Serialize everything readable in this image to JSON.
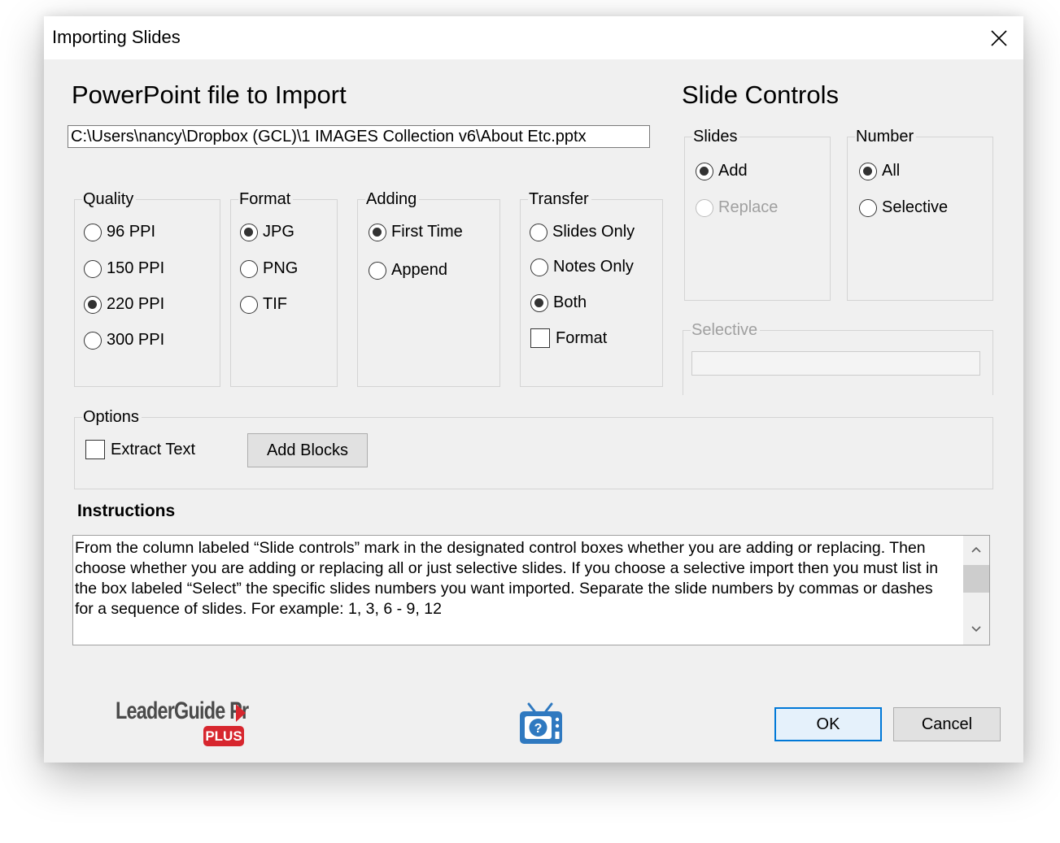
{
  "window": {
    "title": "Importing Slides"
  },
  "import": {
    "heading": "PowerPoint file to Import",
    "file_path": "C:\\Users\\nancy\\Dropbox (GCL)\\1 IMAGES Collection v6\\About Etc.pptx"
  },
  "quality": {
    "label": "Quality",
    "options": [
      "96 PPI",
      "150 PPI",
      "220 PPI",
      "300 PPI"
    ],
    "selected": "220 PPI"
  },
  "format": {
    "label": "Format",
    "options": [
      "JPG",
      "PNG",
      "TIF"
    ],
    "selected": "JPG"
  },
  "adding": {
    "label": "Adding",
    "options": [
      "First Time",
      "Append"
    ],
    "selected": "First Time"
  },
  "transfer": {
    "label": "Transfer",
    "options": [
      "Slides Only",
      "Notes Only",
      "Both"
    ],
    "selected": "Both",
    "format_checkbox": "Format"
  },
  "slide_controls": {
    "heading": "Slide Controls",
    "slides": {
      "label": "Slides",
      "options": [
        "Add",
        "Replace"
      ],
      "selected": "Add"
    },
    "number": {
      "label": "Number",
      "options": [
        "All",
        "Selective"
      ],
      "selected": "All"
    },
    "selective": {
      "label": "Selective",
      "value": ""
    }
  },
  "options": {
    "label": "Options",
    "extract_text": "Extract Text",
    "add_blocks": "Add Blocks"
  },
  "instructions": {
    "label": "Instructions",
    "text": "From the column labeled “Slide controls” mark in the designated control boxes whether you are adding or replacing. Then choose whether you are adding or replacing all or just selective slides. If you choose a selective import then you must list in the box labeled “Select” the specific slides numbers you want imported. Separate the slide numbers by commas or dashes for a sequence of slides.  For example: 1, 3, 6 - 9, 12"
  },
  "logo": {
    "text": "LeaderGuide Pr",
    "badge": "PLUS"
  },
  "footer": {
    "ok": "OK",
    "cancel": "Cancel"
  },
  "icons": {
    "close": "close-icon",
    "help": "tv-help-icon",
    "scroll_up": "chevron-up-icon",
    "scroll_down": "chevron-down-icon"
  },
  "colors": {
    "accent": "#0078d7",
    "help_icon": "#2f79c0",
    "logo_text": "#4a4a4a",
    "logo_red": "#d7262e"
  }
}
